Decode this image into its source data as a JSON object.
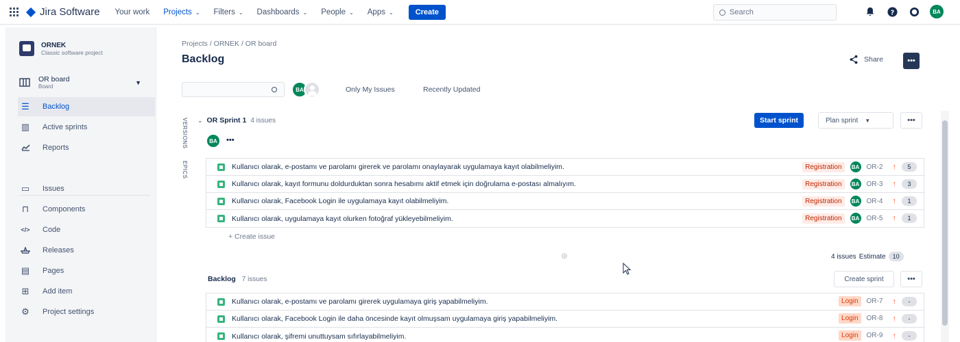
{
  "topnav": {
    "logo": "Jira Software",
    "items": [
      {
        "label": "Your work",
        "active": false,
        "dropdown": false
      },
      {
        "label": "Projects",
        "active": true,
        "dropdown": true
      },
      {
        "label": "Filters",
        "active": false,
        "dropdown": true
      },
      {
        "label": "Dashboards",
        "active": false,
        "dropdown": true
      },
      {
        "label": "People",
        "active": false,
        "dropdown": true
      },
      {
        "label": "Apps",
        "active": false,
        "dropdown": true
      }
    ],
    "create_label": "Create",
    "search_placeholder": "Search",
    "user_initials": "BA"
  },
  "sidebar": {
    "project_name": "ORNEK",
    "project_type": "Classic software project",
    "board_name": "OR board",
    "board_sub": "Board",
    "items": [
      {
        "label": "Backlog",
        "icon": "backlog-icon",
        "active": true
      },
      {
        "label": "Active sprints",
        "icon": "active-sprints-icon",
        "active": false
      },
      {
        "label": "Reports",
        "icon": "reports-icon",
        "active": false
      },
      {
        "label": "Issues",
        "icon": "issues-icon",
        "active": false
      },
      {
        "label": "Components",
        "icon": "components-icon",
        "active": false
      },
      {
        "label": "Code",
        "icon": "code-icon",
        "active": false
      },
      {
        "label": "Releases",
        "icon": "releases-icon",
        "active": false
      },
      {
        "label": "Pages",
        "icon": "pages-icon",
        "active": false
      },
      {
        "label": "Add item",
        "icon": "add-item-icon",
        "active": false
      },
      {
        "label": "Project settings",
        "icon": "settings-icon",
        "active": false
      }
    ]
  },
  "main": {
    "breadcrumb": "Projects / ORNEK / OR board",
    "title": "Backlog",
    "share_label": "Share",
    "more_label": "•••",
    "filter_user_initials": "BA",
    "quick_filters": [
      "Only My Issues",
      "Recently Updated"
    ],
    "side_tabs": [
      "VERSIONS",
      "EPICS"
    ]
  },
  "sprint": {
    "name": "OR Sprint 1",
    "count": "4 issues",
    "assignee_initials": "BA",
    "start_label": "Start sprint",
    "plan_label": "Plan sprint",
    "issues": [
      {
        "summary": "Kullanıcı olarak, e-postamı ve parolamı girerek ve parolamı onaylayarak uygulamaya kayıt olabilmeliyim.",
        "epic": "Registration",
        "key": "OR-2",
        "points": "5"
      },
      {
        "summary": "Kullanıcı olarak, kayıt formunu doldurduktan sonra hesabımı aktif etmek için doğrulama e-postası almalıyım.",
        "epic": "Registration",
        "key": "OR-3",
        "points": "3"
      },
      {
        "summary": "Kullanıcı olarak, Facebook Login ile uygulamaya kayıt olabilmeliyim.",
        "epic": "Registration",
        "key": "OR-4",
        "points": "1"
      },
      {
        "summary": "Kullanıcı olarak, uygulamaya kayıt olurken fotoğraf yükleyebilmeliyim.",
        "epic": "Registration",
        "key": "OR-5",
        "points": "1"
      }
    ],
    "create_issue_label": "+ Create issue",
    "footer_count": "4 issues",
    "footer_estimate_label": "Estimate",
    "footer_estimate_value": "10"
  },
  "backlog": {
    "name": "Backlog",
    "count": "7 issues",
    "create_sprint_label": "Create sprint",
    "issues": [
      {
        "summary": "Kullanıcı olarak, e-postamı ve parolamı girerek uygulamaya giriş yapabilmeliyim.",
        "epic": "Login",
        "key": "OR-7",
        "points": "-"
      },
      {
        "summary": "Kullanıcı olarak, Facebook Login ile daha öncesinde kayıt olmuşsam uygulamaya giriş yapabilmeliyim.",
        "epic": "Login",
        "key": "OR-8",
        "points": "-"
      },
      {
        "summary": "Kullanıcı olarak, şifremi unuttuysam sıfırlayabilmeliyim.",
        "epic": "Login",
        "key": "OR-9",
        "points": "-"
      }
    ]
  },
  "colors": {
    "primary": "#0052cc",
    "registration_bg": "#ffebe6",
    "registration_fg": "#bf2600",
    "login_bg": "#ffd8c7",
    "login_fg": "#de350b",
    "avatar": "#00875a"
  }
}
